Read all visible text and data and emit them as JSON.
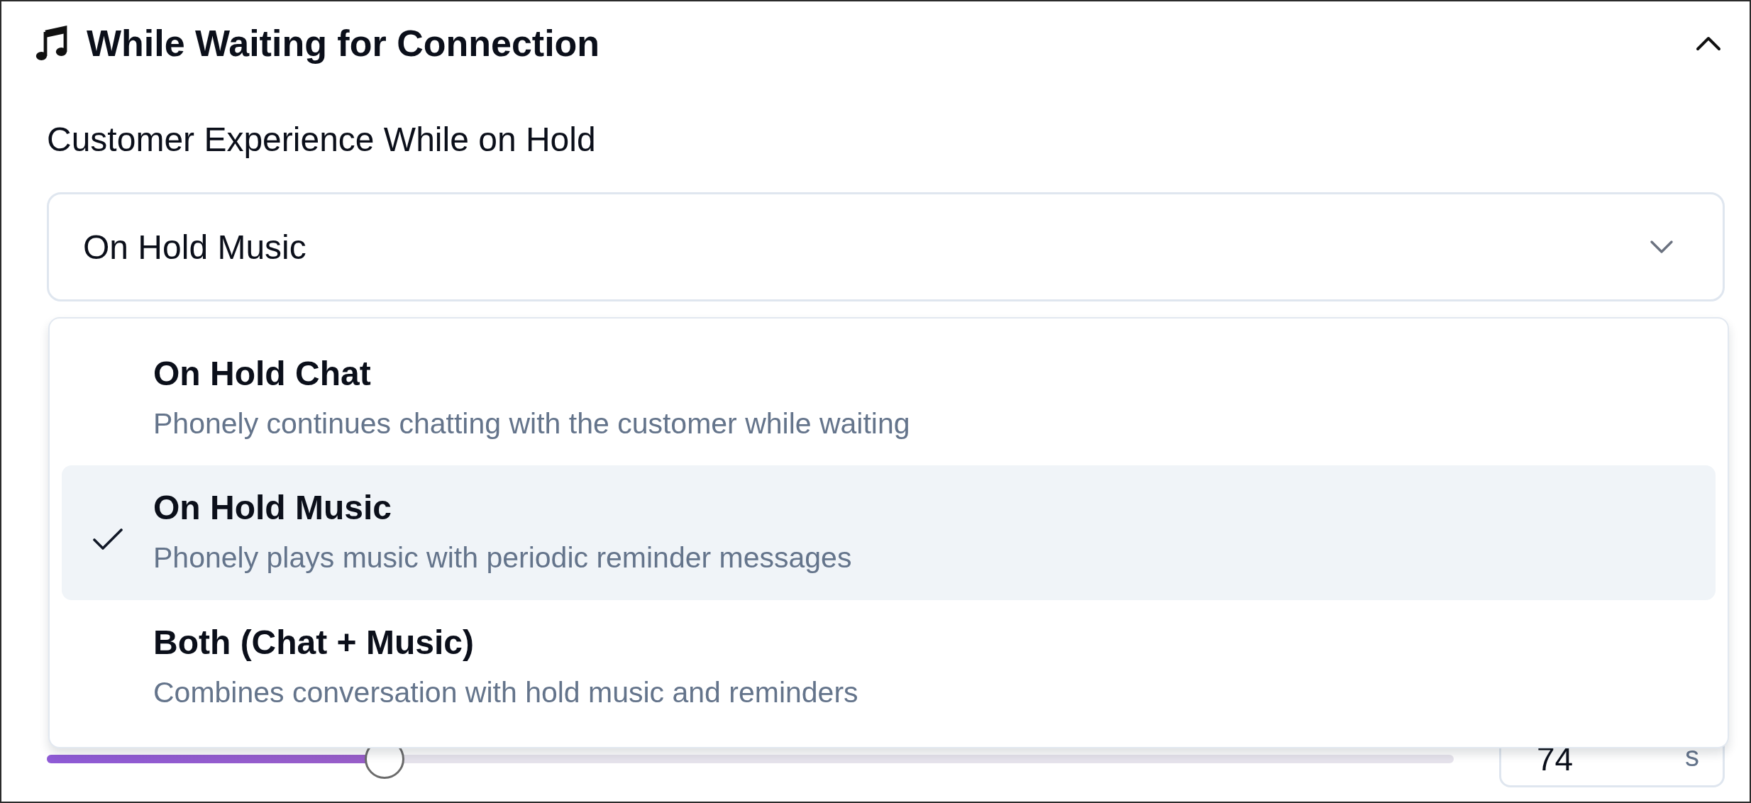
{
  "section": {
    "title": "While Waiting for Connection",
    "expanded": true
  },
  "field": {
    "label": "Customer Experience While on Hold",
    "value": "On Hold Music",
    "open": true
  },
  "options": [
    {
      "title": "On Hold Chat",
      "description": "Phonely continues chatting with the customer while waiting",
      "selected": false
    },
    {
      "title": "On Hold Music",
      "description": "Phonely plays music with periodic reminder messages",
      "selected": true
    },
    {
      "title": "Both (Chat + Music)",
      "description": "Combines conversation with hold music and reminders",
      "selected": false
    }
  ],
  "slider": {
    "level": 0.24
  },
  "number_field": {
    "value": "74",
    "unit": "s"
  }
}
